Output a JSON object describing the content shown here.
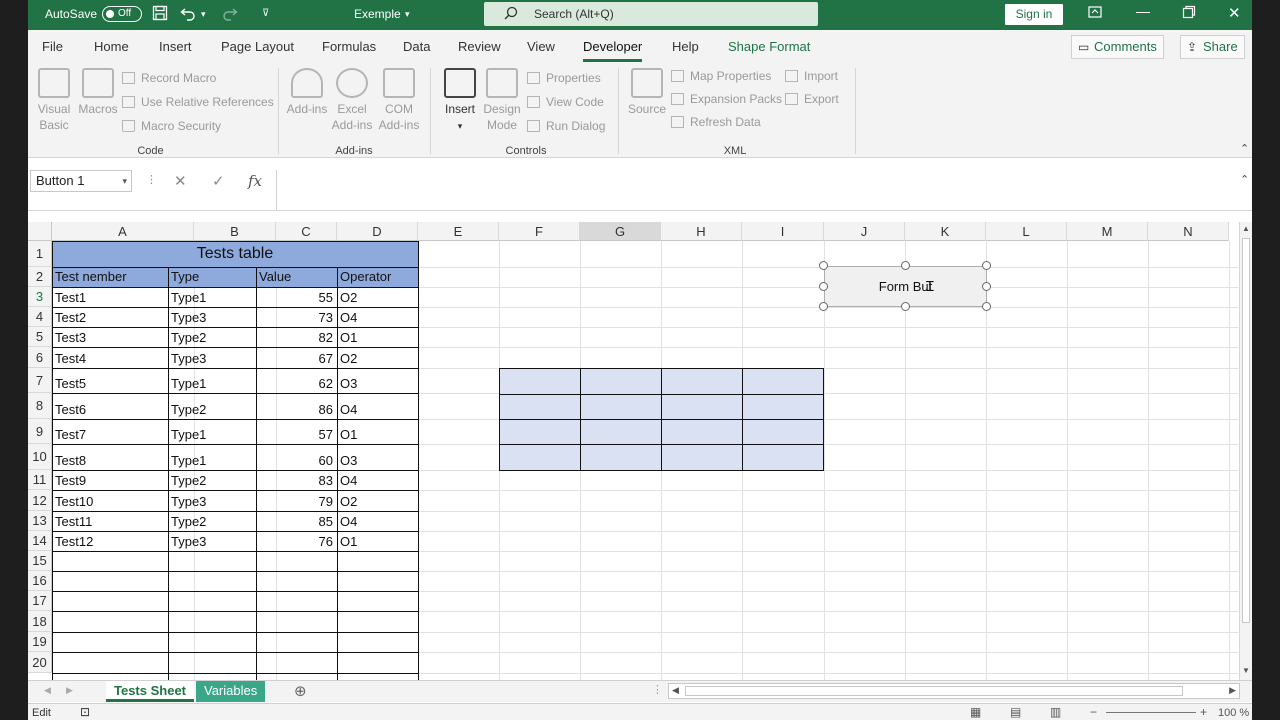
{
  "titlebar": {
    "autosave": "AutoSave",
    "toggle": "Off",
    "filename": "Exemple",
    "search": "Search (Alt+Q)",
    "signin": "Sign in"
  },
  "menu": {
    "tabs": [
      "File",
      "Home",
      "Insert",
      "Page Layout",
      "Formulas",
      "Data",
      "Review",
      "View",
      "Developer",
      "Help",
      "Shape Format"
    ],
    "comments": "Comments",
    "share": "Share"
  },
  "ribbon": {
    "code": {
      "label": "Code",
      "visual_basic": "Visual Basic",
      "macros": "Macros",
      "record_macro": "Record Macro",
      "relative_refs": "Use Relative References",
      "macro_security": "Macro Security"
    },
    "addins": {
      "label": "Add-ins",
      "addins": "Add-ins",
      "excel_addins": "Excel Add-ins",
      "com_addins": "COM Add-ins"
    },
    "controls": {
      "label": "Controls",
      "insert": "Insert",
      "design_mode": "Design Mode",
      "properties": "Properties",
      "view_code": "View Code",
      "run_dialog": "Run Dialog"
    },
    "xml": {
      "label": "XML",
      "source": "Source",
      "map_properties": "Map Properties",
      "expansion_packs": "Expansion Packs",
      "refresh_data": "Refresh Data",
      "import": "Import",
      "export": "Export"
    }
  },
  "formula_bar": {
    "name_box": "Button 1",
    "fx": "fx",
    "value": ""
  },
  "grid": {
    "columns": [
      "A",
      "B",
      "C",
      "D",
      "E",
      "F",
      "G",
      "H",
      "I",
      "J",
      "K",
      "L",
      "M",
      "N"
    ],
    "rows": [
      "1",
      "2",
      "3",
      "4",
      "5",
      "6",
      "7",
      "8",
      "9",
      "10",
      "11",
      "12",
      "13",
      "14",
      "15",
      "16",
      "17",
      "18",
      "19",
      "20"
    ],
    "table_title": "Tests table",
    "headers": [
      "Test nember",
      "Type",
      "Value",
      "Operator"
    ],
    "data": [
      [
        "Test1",
        "Type1",
        "55",
        "O2"
      ],
      [
        "Test2",
        "Type3",
        "73",
        "O4"
      ],
      [
        "Test3",
        "Type2",
        "82",
        "O1"
      ],
      [
        "Test4",
        "Type3",
        "67",
        "O2"
      ],
      [
        "Test5",
        "Type1",
        "62",
        "O3"
      ],
      [
        "Test6",
        "Type2",
        "86",
        "O4"
      ],
      [
        "Test7",
        "Type1",
        "57",
        "O1"
      ],
      [
        "Test8",
        "Type1",
        "60",
        "O3"
      ],
      [
        "Test9",
        "Type2",
        "83",
        "O4"
      ],
      [
        "Test10",
        "Type3",
        "79",
        "O2"
      ],
      [
        "Test11",
        "Type2",
        "85",
        "O4"
      ],
      [
        "Test12",
        "Type3",
        "76",
        "O1"
      ]
    ],
    "form_button": "Form But"
  },
  "sheets": {
    "active": "Tests Sheet",
    "other": "Variables"
  },
  "status": {
    "mode": "Edit",
    "zoom": "100 %"
  },
  "colors": {
    "excel_green": "#217346",
    "table_header": "#8ea9db",
    "light_blue": "#d9e1f2"
  }
}
